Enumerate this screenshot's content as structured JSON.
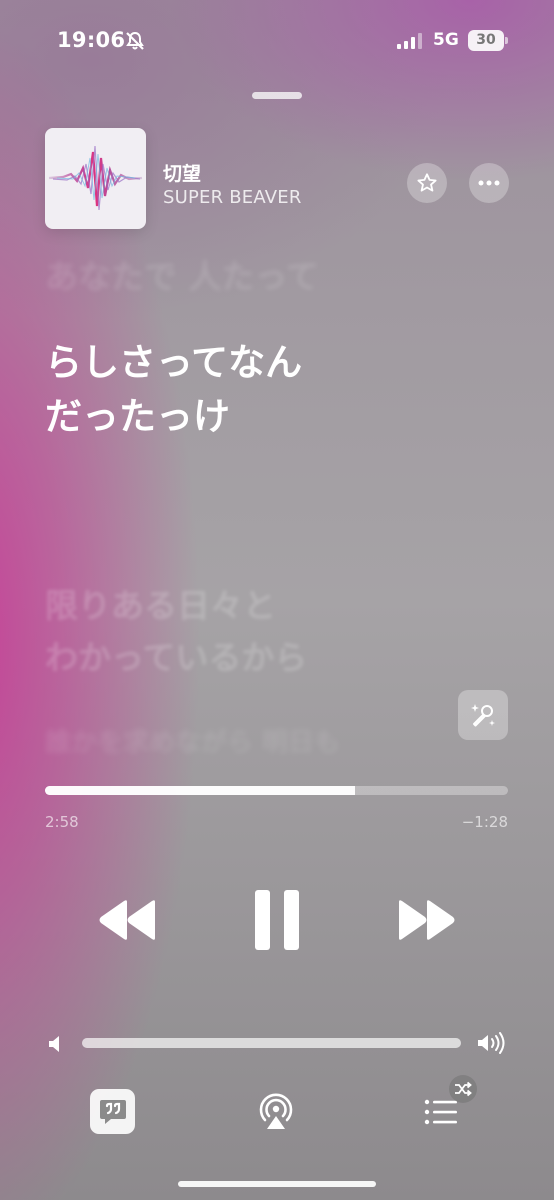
{
  "status_bar": {
    "time": "19:06",
    "network": "5G",
    "battery": "30",
    "icons": [
      "bell-slash-icon",
      "signal-icon"
    ]
  },
  "now_playing": {
    "title": "切望",
    "artist": "SUPER BEAVER",
    "artwork_icon": "soundwave-artwork",
    "favorite_icon": "star-icon",
    "more_icon": "ellipsis-icon"
  },
  "lyrics": {
    "previous": "あなたで 人たって",
    "current_line_1": "らしさってなん",
    "current_line_2": "だったっけ",
    "next_line_1": "限りある日々と",
    "next_line_2": "わかっているから",
    "next2": "誰かを求めながら 明日も"
  },
  "playback": {
    "elapsed": "2:58",
    "remaining": "−1:28",
    "progress": 0.67,
    "state": "playing",
    "controls": [
      "rewind-icon",
      "pause-icon",
      "fast-forward-icon"
    ]
  },
  "volume": {
    "level": 1.0,
    "icons": [
      "speaker-low-icon",
      "speaker-high-icon"
    ]
  },
  "toolbar": {
    "items": [
      "lyrics-icon",
      "airplay-icon",
      "queue-icon"
    ],
    "shuffle_badge": "shuffle-icon",
    "lyrics_active": true
  },
  "colors": {
    "accent_pink": "#c93896",
    "background_gray": "#a6a3a6",
    "text_white": "#ffffff"
  }
}
